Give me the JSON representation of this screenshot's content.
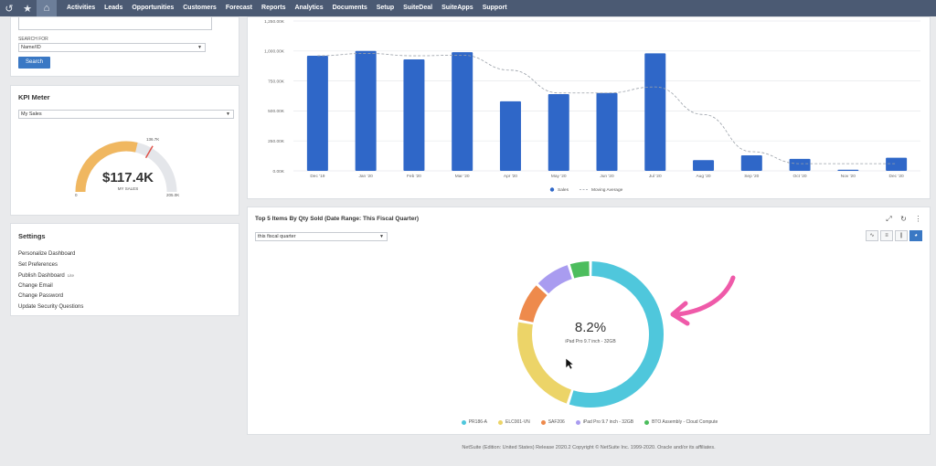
{
  "nav": {
    "items": [
      "Activities",
      "Leads",
      "Opportunities",
      "Customers",
      "Forecast",
      "Reports",
      "Analytics",
      "Documents",
      "Setup",
      "SuiteDeal",
      "SuiteApps",
      "Support"
    ]
  },
  "search": {
    "search_for_label": "SEARCH FOR",
    "select_value": "Name/ID",
    "button_label": "Search"
  },
  "kpi": {
    "title": "KPI Meter",
    "select_value": "My Sales",
    "value": "$117.4K",
    "sub_label": "MY SALES",
    "min_label": "0",
    "max_label": "205.0K",
    "target_label": "136.7K",
    "fill_fraction": 0.573,
    "target_fraction": 0.667
  },
  "settings": {
    "title": "Settings",
    "links": [
      {
        "label": "Personalize Dashboard",
        "extra": ""
      },
      {
        "label": "Set Preferences",
        "extra": ""
      },
      {
        "label": "Publish Dashboard",
        "extra": "Lite"
      },
      {
        "label": "Change Email",
        "extra": ""
      },
      {
        "label": "Change Password",
        "extra": ""
      },
      {
        "label": "Update Security Questions",
        "extra": ""
      }
    ]
  },
  "top5": {
    "title": "Top 5 Items By Qty Sold (Date Range: This Fiscal Quarter)",
    "period_value": "this fiscal quarter",
    "center_pct": "8.2%",
    "center_item": "iPad Pro 9.7 inch - 32GB"
  },
  "footer": {
    "text": "NetSuite (Edition: United States) Release 2020.2 Copyright © NetSuite Inc. 1999-2020. Oracle and/or its affiliates."
  },
  "colors": {
    "nav_bg": "#4b5a73",
    "bar": "#2f67c8",
    "accent": "#3a78c4",
    "gauge_fill": "#f0b760",
    "arrow": "#ef5aa9"
  },
  "chart_data": [
    {
      "type": "bar",
      "categories": [
        "Dec '19",
        "Jan '20",
        "Feb '20",
        "Mar '20",
        "Apr '20",
        "May '20",
        "Jun '20",
        "Jul '20",
        "Aug '20",
        "Sep '20",
        "Oct '20",
        "Nov '20",
        "Dec '20"
      ],
      "series": [
        {
          "name": "Sales",
          "values": [
            960000,
            1000000,
            930000,
            990000,
            580000,
            640000,
            650000,
            980000,
            90000,
            130000,
            100000,
            10000,
            110000
          ]
        },
        {
          "name": "Moving Average",
          "values": [
            960000,
            980000,
            960000,
            965000,
            840000,
            650000,
            650000,
            700000,
            470000,
            160000,
            60000,
            60000,
            60000
          ]
        }
      ],
      "y_ticks": [
        "0.00K",
        "250.00K",
        "500.00K",
        "750.00K",
        "1,000.00K",
        "1,250.00K"
      ],
      "ylim": [
        0,
        1250000
      ],
      "legend": "bottom",
      "grid": true
    },
    {
      "type": "pie",
      "categories": [
        "PR186-A",
        "ELC001-VN",
        "SAF206",
        "iPad Pro 9.7 inch - 32GB",
        "BTO Assembly - Cloud Compute"
      ],
      "values": [
        55,
        23,
        9,
        8.2,
        4.8
      ],
      "colors": [
        "#4fc7dc",
        "#ecd468",
        "#ee8a4c",
        "#a99cf0",
        "#4cbd5d"
      ],
      "legend": "bottom",
      "donut": true
    }
  ]
}
